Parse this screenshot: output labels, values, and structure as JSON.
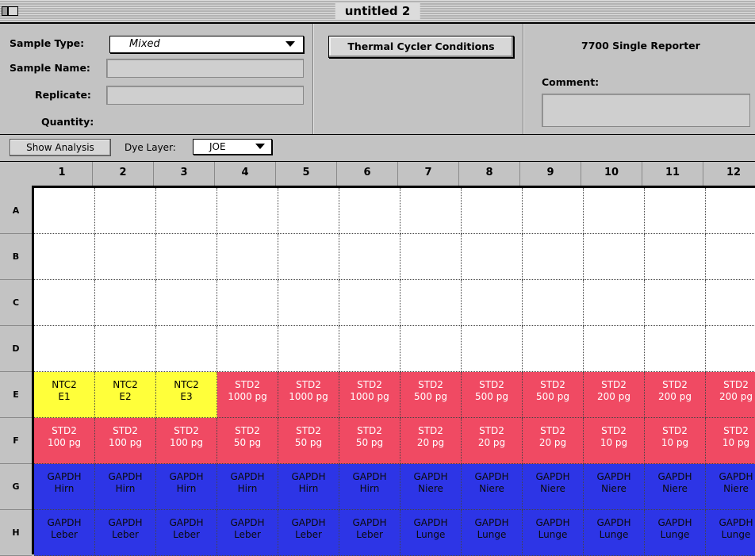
{
  "window": {
    "title": "untitled 2"
  },
  "header": {
    "sample_type_label": "Sample Type:",
    "sample_type_value": "Mixed",
    "sample_name_label": "Sample Name:",
    "sample_name_value": "",
    "replicate_label": "Replicate:",
    "replicate_value": "",
    "quantity_label": "Quantity:",
    "tcc_button": "Thermal Cycler Conditions",
    "instrument": "7700 Single Reporter",
    "comment_label": "Comment:",
    "comment_value": ""
  },
  "toolbar": {
    "show_analysis": "Show Analysis",
    "dye_layer_label": "Dye Layer:",
    "dye_layer_value": "JOE"
  },
  "colors": {
    "yellow": "#ffff3a",
    "red": "#f04a63",
    "blue": "#2d35e6",
    "white": "#ffffff"
  },
  "plate": {
    "columns": [
      "1",
      "2",
      "3",
      "4",
      "5",
      "6",
      "7",
      "8",
      "9",
      "10",
      "11",
      "12"
    ],
    "rows": [
      "A",
      "B",
      "C",
      "D",
      "E",
      "F",
      "G",
      "H"
    ],
    "row_data": [
      {
        "row": "A",
        "wells": []
      },
      {
        "row": "B",
        "wells": []
      },
      {
        "row": "C",
        "wells": []
      },
      {
        "row": "D",
        "wells": []
      },
      {
        "row": "E",
        "wells": [
          {
            "l1": "NTC2",
            "l2": "E1",
            "color": "yellow"
          },
          {
            "l1": "NTC2",
            "l2": "E2",
            "color": "yellow"
          },
          {
            "l1": "NTC2",
            "l2": "E3",
            "color": "yellow"
          },
          {
            "l1": "STD2",
            "l2": "1000 pg",
            "color": "red"
          },
          {
            "l1": "STD2",
            "l2": "1000 pg",
            "color": "red"
          },
          {
            "l1": "STD2",
            "l2": "1000 pg",
            "color": "red"
          },
          {
            "l1": "STD2",
            "l2": "500 pg",
            "color": "red"
          },
          {
            "l1": "STD2",
            "l2": "500 pg",
            "color": "red"
          },
          {
            "l1": "STD2",
            "l2": "500 pg",
            "color": "red"
          },
          {
            "l1": "STD2",
            "l2": "200 pg",
            "color": "red"
          },
          {
            "l1": "STD2",
            "l2": "200 pg",
            "color": "red"
          },
          {
            "l1": "STD2",
            "l2": "200 pg",
            "color": "red"
          }
        ]
      },
      {
        "row": "F",
        "wells": [
          {
            "l1": "STD2",
            "l2": "100 pg",
            "color": "red"
          },
          {
            "l1": "STD2",
            "l2": "100 pg",
            "color": "red"
          },
          {
            "l1": "STD2",
            "l2": "100 pg",
            "color": "red"
          },
          {
            "l1": "STD2",
            "l2": "50 pg",
            "color": "red"
          },
          {
            "l1": "STD2",
            "l2": "50 pg",
            "color": "red"
          },
          {
            "l1": "STD2",
            "l2": "50 pg",
            "color": "red"
          },
          {
            "l1": "STD2",
            "l2": "20 pg",
            "color": "red"
          },
          {
            "l1": "STD2",
            "l2": "20 pg",
            "color": "red"
          },
          {
            "l1": "STD2",
            "l2": "20 pg",
            "color": "red"
          },
          {
            "l1": "STD2",
            "l2": "10 pg",
            "color": "red"
          },
          {
            "l1": "STD2",
            "l2": "10 pg",
            "color": "red"
          },
          {
            "l1": "STD2",
            "l2": "10 pg",
            "color": "red"
          }
        ]
      },
      {
        "row": "G",
        "wells": [
          {
            "l1": "GAPDH",
            "l2": "Hirn",
            "color": "blue"
          },
          {
            "l1": "GAPDH",
            "l2": "Hirn",
            "color": "blue"
          },
          {
            "l1": "GAPDH",
            "l2": "Hirn",
            "color": "blue"
          },
          {
            "l1": "GAPDH",
            "l2": "Hirn",
            "color": "blue"
          },
          {
            "l1": "GAPDH",
            "l2": "Hirn",
            "color": "blue"
          },
          {
            "l1": "GAPDH",
            "l2": "Hirn",
            "color": "blue"
          },
          {
            "l1": "GAPDH",
            "l2": "Niere",
            "color": "blue"
          },
          {
            "l1": "GAPDH",
            "l2": "Niere",
            "color": "blue"
          },
          {
            "l1": "GAPDH",
            "l2": "Niere",
            "color": "blue"
          },
          {
            "l1": "GAPDH",
            "l2": "Niere",
            "color": "blue"
          },
          {
            "l1": "GAPDH",
            "l2": "Niere",
            "color": "blue"
          },
          {
            "l1": "GAPDH",
            "l2": "Niere",
            "color": "blue"
          }
        ]
      },
      {
        "row": "H",
        "wells": [
          {
            "l1": "GAPDH",
            "l2": "Leber",
            "color": "blue"
          },
          {
            "l1": "GAPDH",
            "l2": "Leber",
            "color": "blue"
          },
          {
            "l1": "GAPDH",
            "l2": "Leber",
            "color": "blue"
          },
          {
            "l1": "GAPDH",
            "l2": "Leber",
            "color": "blue"
          },
          {
            "l1": "GAPDH",
            "l2": "Leber",
            "color": "blue"
          },
          {
            "l1": "GAPDH",
            "l2": "Leber",
            "color": "blue"
          },
          {
            "l1": "GAPDH",
            "l2": "Lunge",
            "color": "blue"
          },
          {
            "l1": "GAPDH",
            "l2": "Lunge",
            "color": "blue"
          },
          {
            "l1": "GAPDH",
            "l2": "Lunge",
            "color": "blue"
          },
          {
            "l1": "GAPDH",
            "l2": "Lunge",
            "color": "blue"
          },
          {
            "l1": "GAPDH",
            "l2": "Lunge",
            "color": "blue"
          },
          {
            "l1": "GAPDH",
            "l2": "Lunge",
            "color": "blue"
          }
        ]
      }
    ]
  }
}
